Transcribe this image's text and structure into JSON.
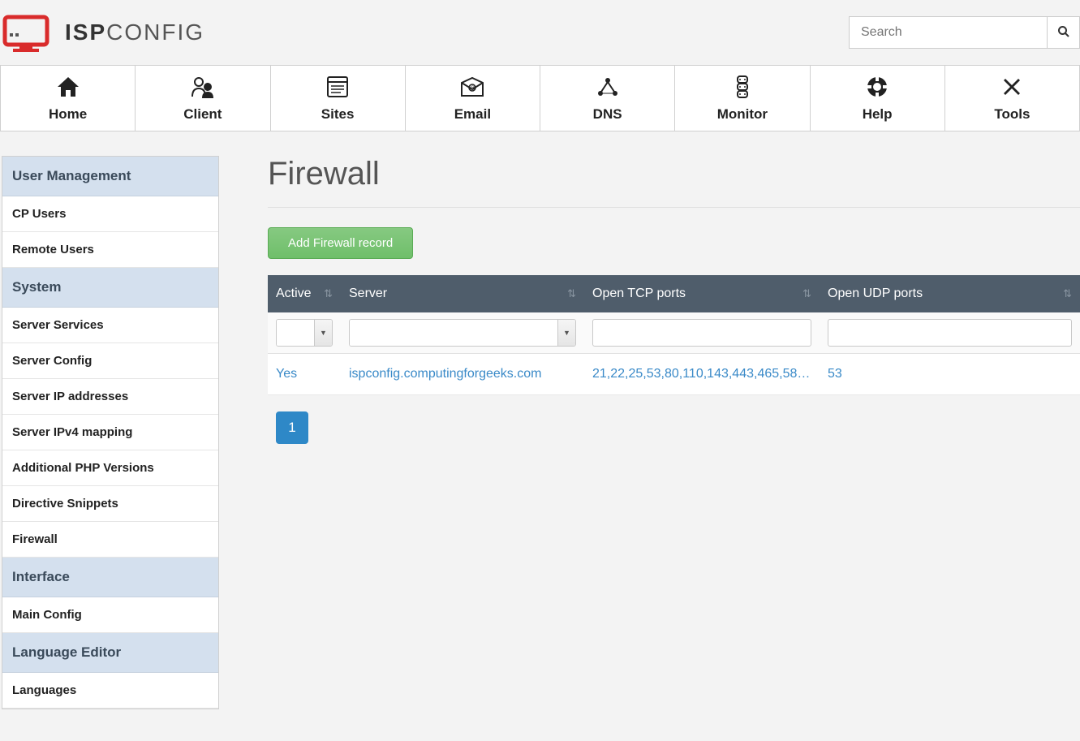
{
  "logo": {
    "text_bold": "ISP",
    "text_light": "CONFIG"
  },
  "search": {
    "placeholder": "Search"
  },
  "topnav": [
    {
      "label": "Home"
    },
    {
      "label": "Client"
    },
    {
      "label": "Sites"
    },
    {
      "label": "Email"
    },
    {
      "label": "DNS"
    },
    {
      "label": "Monitor"
    },
    {
      "label": "Help"
    },
    {
      "label": "Tools"
    }
  ],
  "sidebar": {
    "sections": [
      {
        "title": "User Management",
        "items": [
          "CP Users",
          "Remote Users"
        ]
      },
      {
        "title": "System",
        "items": [
          "Server Services",
          "Server Config",
          "Server IP addresses",
          "Server IPv4 mapping",
          "Additional PHP Versions",
          "Directive Snippets",
          "Firewall"
        ]
      },
      {
        "title": "Interface",
        "items": [
          "Main Config"
        ]
      },
      {
        "title": "Language Editor",
        "items": [
          "Languages"
        ]
      }
    ]
  },
  "page": {
    "title": "Firewall",
    "add_button": "Add Firewall record"
  },
  "table": {
    "columns": [
      "Active",
      "Server",
      "Open TCP ports",
      "Open UDP ports"
    ],
    "rows": [
      {
        "active": "Yes",
        "server": "ispconfig.computingforgeeks.com",
        "tcp": "21,22,25,53,80,110,143,443,465,58…",
        "udp": "53"
      }
    ]
  },
  "pagination": {
    "current": "1"
  }
}
